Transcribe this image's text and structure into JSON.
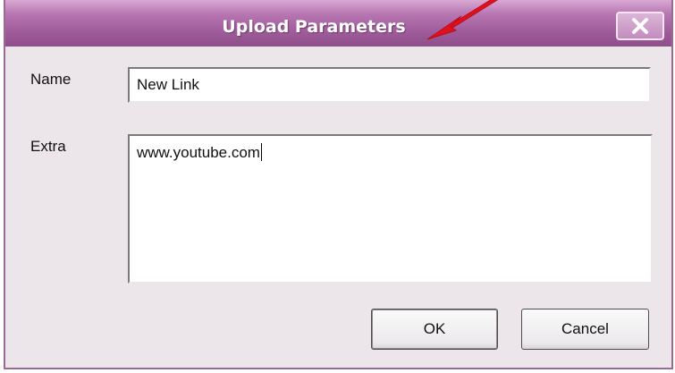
{
  "dialog": {
    "title": "Upload Parameters",
    "close_icon": "close-x-icon"
  },
  "form": {
    "name_label": "Name",
    "name_value": "New Link",
    "extra_label": "Extra",
    "extra_value": "www.youtube.com"
  },
  "buttons": {
    "ok_label": "OK",
    "cancel_label": "Cancel"
  },
  "annotation": {
    "icon": "red-arrow-icon",
    "color": "#e0101e"
  },
  "colors": {
    "titlebar": "#9e5b9a",
    "dialog_bg": "#ece6ea"
  }
}
